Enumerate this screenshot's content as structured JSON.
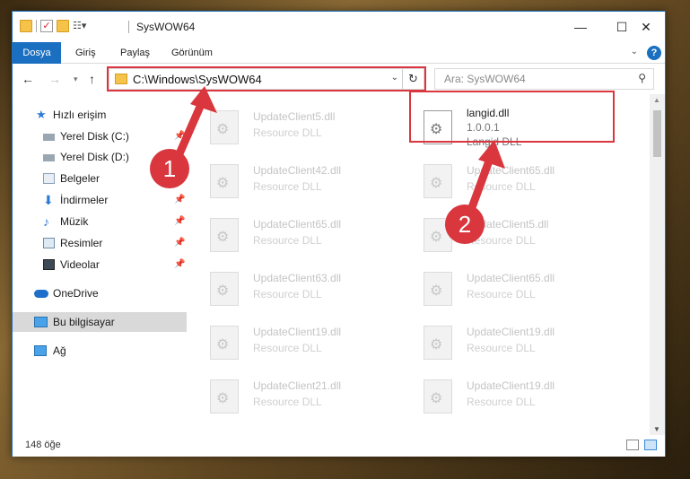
{
  "window": {
    "title": "SysWOW64",
    "controls": {
      "minimize": "—",
      "maximize": "☐",
      "close": "✕"
    }
  },
  "ribbon": {
    "tabs": [
      "Dosya",
      "Giriş",
      "Paylaş",
      "Görünüm"
    ],
    "help": "?"
  },
  "nav": {
    "back": "←",
    "forward": "→",
    "up": "↑",
    "address": "C:\\Windows\\SysWOW64",
    "refresh": "↻",
    "search_placeholder": "Ara: SysWOW64"
  },
  "sidebar": {
    "items": [
      {
        "label": "Hızlı erişim",
        "icon": "star-icon"
      },
      {
        "label": "Yerel Disk (C:)",
        "icon": "drive-icon",
        "pinned": true
      },
      {
        "label": "Yerel Disk (D:)",
        "icon": "drive-icon"
      },
      {
        "label": "Belgeler",
        "icon": "documents-icon"
      },
      {
        "label": "İndirmeler",
        "icon": "downloads-icon",
        "pinned": true
      },
      {
        "label": "Müzik",
        "icon": "music-icon",
        "pinned": true
      },
      {
        "label": "Resimler",
        "icon": "pictures-icon",
        "pinned": true
      },
      {
        "label": "Videolar",
        "icon": "videos-icon",
        "pinned": true
      },
      {
        "label": "OneDrive",
        "icon": "cloud-icon"
      },
      {
        "label": "Bu bilgisayar",
        "icon": "computer-icon",
        "selected": true
      },
      {
        "label": "Ağ",
        "icon": "network-icon"
      }
    ],
    "pin_glyph": "📌"
  },
  "files": {
    "highlight": {
      "name": "langid.dll",
      "version": "1.0.0.1",
      "type": "Langid DLL"
    },
    "left_column": [
      {
        "name": "UpdateClient5.dll",
        "type": "Resource DLL"
      },
      {
        "name": "UpdateClient42.dll",
        "type": "Resource DLL"
      },
      {
        "name": "UpdateClient65.dll",
        "type": "Resource DLL"
      },
      {
        "name": "UpdateClient63.dll",
        "type": "Resource DLL"
      },
      {
        "name": "UpdateClient19.dll",
        "type": "Resource DLL"
      },
      {
        "name": "UpdateClient21.dll",
        "type": "Resource DLL"
      }
    ],
    "right_column": [
      {
        "name": "UpdateClient65.dll",
        "type": "Resource DLL"
      },
      {
        "name": "UpdateClient5.dll",
        "type": "Resource DLL"
      },
      {
        "name": "UpdateClient65.dll",
        "type": "Resource DLL"
      },
      {
        "name": "UpdateClient19.dll",
        "type": "Resource DLL"
      },
      {
        "name": "UpdateClient19.dll",
        "type": "Resource DLL"
      }
    ]
  },
  "status": {
    "count": "148 öğe"
  },
  "annotations": {
    "step1": "1",
    "step2": "2",
    "color": "#d9363e"
  }
}
